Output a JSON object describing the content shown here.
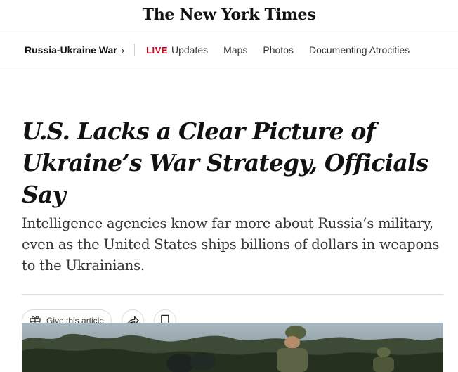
{
  "masthead": {
    "logo_text": "The New York Times"
  },
  "subnav": {
    "section_label": "Russia-Ukraine War",
    "section_chevron": "›",
    "live_label": "LIVE",
    "links": [
      "Updates",
      "Maps",
      "Photos",
      "Documenting Atrocities"
    ]
  },
  "article": {
    "headline": "U.S. Lacks a Clear Picture of Ukraine’s War Strategy, Officials Say",
    "summary": "Intelligence agencies know far more about Russia’s military, even as the United States ships billions of dollars in weapons to the Ukrainians."
  },
  "tools": {
    "gift_label": "Give this article",
    "gift_icon": "gift-icon",
    "share_icon": "share-icon",
    "save_icon": "bookmark-icon"
  },
  "colors": {
    "live_red": "#d0021b",
    "text": "#121212",
    "summary_text": "#363636",
    "rule": "#dfdfdf"
  }
}
